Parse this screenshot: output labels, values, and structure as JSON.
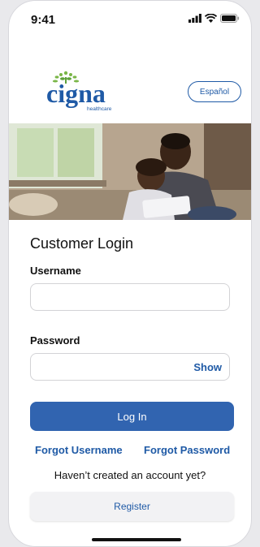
{
  "status_bar": {
    "time": "9:41"
  },
  "header": {
    "logo_wordmark": "cigna",
    "logo_tagline": "healthcare",
    "language_button": "Español"
  },
  "hero": {
    "icon": "photo-father-child-tablet"
  },
  "login": {
    "title": "Customer Login",
    "username_label": "Username",
    "username_value": "",
    "password_label": "Password",
    "password_value": "",
    "show_label": "Show",
    "login_button": "Log In",
    "forgot_username": "Forgot Username",
    "forgot_password": "Forgot Password",
    "no_account_text": "Haven’t created an account yet?",
    "register_button": "Register"
  },
  "colors": {
    "brand_blue": "#1f5aa6",
    "button_blue": "#3164b0",
    "leaf_green": "#7ab648"
  }
}
